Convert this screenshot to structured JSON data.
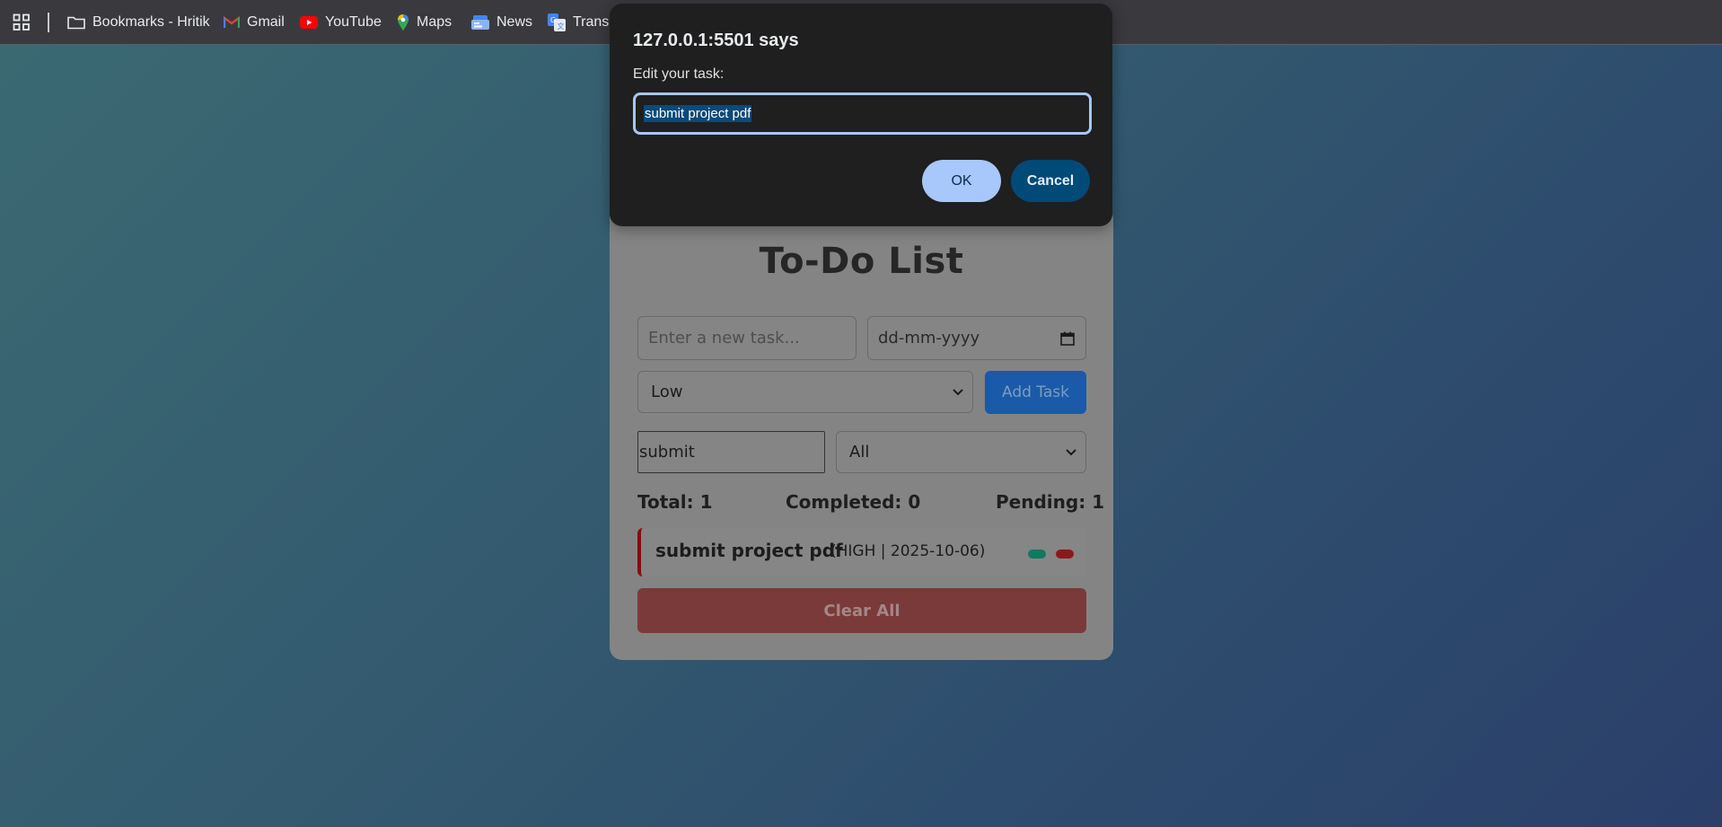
{
  "bookmarks_bar": {
    "items": [
      {
        "label": "Bookmarks - Hritik",
        "icon": "folder-icon"
      },
      {
        "label": "Gmail",
        "icon": "gmail-icon"
      },
      {
        "label": "YouTube",
        "icon": "youtube-icon"
      },
      {
        "label": "Maps",
        "icon": "maps-icon"
      },
      {
        "label": "News",
        "icon": "news-icon"
      },
      {
        "label": "Transla",
        "icon": "translate-icon"
      }
    ]
  },
  "dialog": {
    "origin": "127.0.0.1:5501 says",
    "message": "Edit your task:",
    "input_value": "submit project pdf",
    "ok_label": "OK",
    "cancel_label": "Cancel"
  },
  "app": {
    "title": "To-Do List",
    "task_input_placeholder": "Enter a new task...",
    "date_placeholder": "dd-mm-yyyy",
    "priority_selected": "Low",
    "add_button_label": "Add Task",
    "search_value": "submit",
    "filter_selected": "All",
    "stats": {
      "total": "Total: 1",
      "completed": "Completed: 0",
      "pending": "Pending: 1"
    },
    "tasks": [
      {
        "name": "submit project pdf",
        "meta": "(HIGH | 2025-10-06)"
      }
    ],
    "clear_button_label": "Clear All"
  },
  "colors": {
    "priority_high": "#8a0a0a",
    "complete_pill": "#0f7a60",
    "delete_pill": "#8a1a1a",
    "dialog_ok": "#a8c7fa",
    "dialog_cancel": "#004a77"
  }
}
